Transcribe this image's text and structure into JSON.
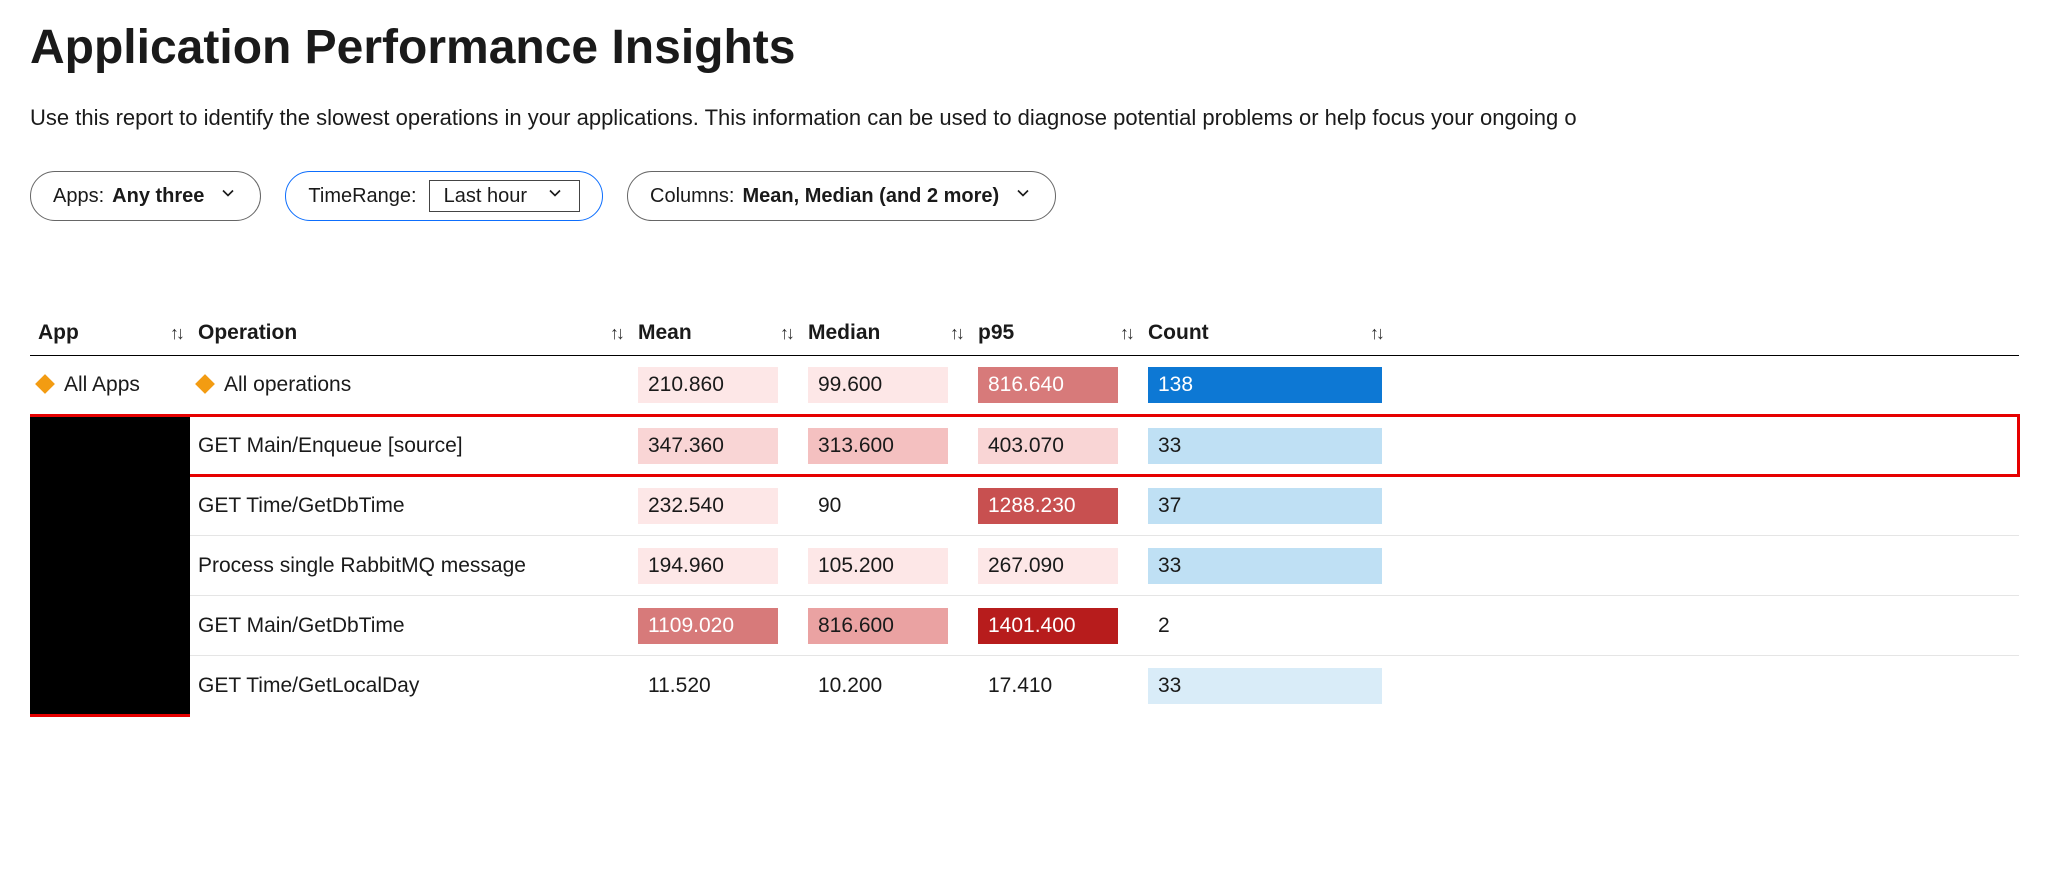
{
  "header": {
    "title": "Application Performance Insights",
    "description": "Use this report to identify the slowest operations in your applications. This information can be used to diagnose potential problems or help focus your ongoing o"
  },
  "filters": {
    "apps": {
      "label": "Apps:",
      "value": "Any three"
    },
    "time": {
      "label": "TimeRange:",
      "value": "Last hour"
    },
    "cols": {
      "label": "Columns:",
      "value": "Mean, Median (and 2 more)"
    }
  },
  "columns": {
    "app": "App",
    "operation": "Operation",
    "mean": "Mean",
    "median": "Median",
    "p95": "p95",
    "count": "Count"
  },
  "summary": {
    "app": "All Apps",
    "operation": "All operations",
    "mean": "210.860",
    "median": "99.600",
    "p95": "816.640",
    "count": "138"
  },
  "rows": [
    {
      "operation": "GET Main/Enqueue [source]",
      "mean": "347.360",
      "median": "313.600",
      "p95": "403.070",
      "count": "33",
      "highlight": true,
      "shades": {
        "mean": "r1",
        "median": "r2",
        "p95": "r1",
        "count": "b1"
      }
    },
    {
      "operation": "GET Time/GetDbTime",
      "mean": "232.540",
      "median": "90",
      "p95": "1288.230",
      "count": "37",
      "shades": {
        "mean": "r0",
        "median": "",
        "p95": "r5",
        "count": "b1"
      }
    },
    {
      "operation": "Process single RabbitMQ message",
      "mean": "194.960",
      "median": "105.200",
      "p95": "267.090",
      "count": "33",
      "shades": {
        "mean": "r0",
        "median": "r0",
        "p95": "r0",
        "count": "b1"
      }
    },
    {
      "operation": "GET Main/GetDbTime",
      "mean": "1109.020",
      "median": "816.600",
      "p95": "1401.400",
      "count": "2",
      "shades": {
        "mean": "r4",
        "median": "r3",
        "p95": "r6",
        "count": ""
      }
    },
    {
      "operation": "GET Time/GetLocalDay",
      "mean": "11.520",
      "median": "10.200",
      "p95": "17.410",
      "count": "33",
      "shades": {
        "mean": "",
        "median": "",
        "p95": "",
        "count": "b0"
      }
    }
  ]
}
